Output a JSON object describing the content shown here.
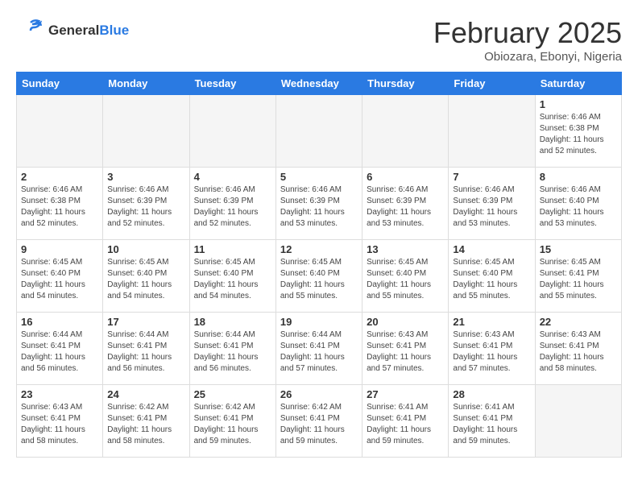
{
  "logo": {
    "general": "General",
    "blue": "Blue"
  },
  "title": "February 2025",
  "location": "Obiozara, Ebonyi, Nigeria",
  "weekdays": [
    "Sunday",
    "Monday",
    "Tuesday",
    "Wednesday",
    "Thursday",
    "Friday",
    "Saturday"
  ],
  "weeks": [
    [
      {
        "day": "",
        "info": ""
      },
      {
        "day": "",
        "info": ""
      },
      {
        "day": "",
        "info": ""
      },
      {
        "day": "",
        "info": ""
      },
      {
        "day": "",
        "info": ""
      },
      {
        "day": "",
        "info": ""
      },
      {
        "day": "1",
        "info": "Sunrise: 6:46 AM\nSunset: 6:38 PM\nDaylight: 11 hours\nand 52 minutes."
      }
    ],
    [
      {
        "day": "2",
        "info": "Sunrise: 6:46 AM\nSunset: 6:38 PM\nDaylight: 11 hours\nand 52 minutes."
      },
      {
        "day": "3",
        "info": "Sunrise: 6:46 AM\nSunset: 6:39 PM\nDaylight: 11 hours\nand 52 minutes."
      },
      {
        "day": "4",
        "info": "Sunrise: 6:46 AM\nSunset: 6:39 PM\nDaylight: 11 hours\nand 52 minutes."
      },
      {
        "day": "5",
        "info": "Sunrise: 6:46 AM\nSunset: 6:39 PM\nDaylight: 11 hours\nand 53 minutes."
      },
      {
        "day": "6",
        "info": "Sunrise: 6:46 AM\nSunset: 6:39 PM\nDaylight: 11 hours\nand 53 minutes."
      },
      {
        "day": "7",
        "info": "Sunrise: 6:46 AM\nSunset: 6:39 PM\nDaylight: 11 hours\nand 53 minutes."
      },
      {
        "day": "8",
        "info": "Sunrise: 6:46 AM\nSunset: 6:40 PM\nDaylight: 11 hours\nand 53 minutes."
      }
    ],
    [
      {
        "day": "9",
        "info": "Sunrise: 6:45 AM\nSunset: 6:40 PM\nDaylight: 11 hours\nand 54 minutes."
      },
      {
        "day": "10",
        "info": "Sunrise: 6:45 AM\nSunset: 6:40 PM\nDaylight: 11 hours\nand 54 minutes."
      },
      {
        "day": "11",
        "info": "Sunrise: 6:45 AM\nSunset: 6:40 PM\nDaylight: 11 hours\nand 54 minutes."
      },
      {
        "day": "12",
        "info": "Sunrise: 6:45 AM\nSunset: 6:40 PM\nDaylight: 11 hours\nand 55 minutes."
      },
      {
        "day": "13",
        "info": "Sunrise: 6:45 AM\nSunset: 6:40 PM\nDaylight: 11 hours\nand 55 minutes."
      },
      {
        "day": "14",
        "info": "Sunrise: 6:45 AM\nSunset: 6:40 PM\nDaylight: 11 hours\nand 55 minutes."
      },
      {
        "day": "15",
        "info": "Sunrise: 6:45 AM\nSunset: 6:41 PM\nDaylight: 11 hours\nand 55 minutes."
      }
    ],
    [
      {
        "day": "16",
        "info": "Sunrise: 6:44 AM\nSunset: 6:41 PM\nDaylight: 11 hours\nand 56 minutes."
      },
      {
        "day": "17",
        "info": "Sunrise: 6:44 AM\nSunset: 6:41 PM\nDaylight: 11 hours\nand 56 minutes."
      },
      {
        "day": "18",
        "info": "Sunrise: 6:44 AM\nSunset: 6:41 PM\nDaylight: 11 hours\nand 56 minutes."
      },
      {
        "day": "19",
        "info": "Sunrise: 6:44 AM\nSunset: 6:41 PM\nDaylight: 11 hours\nand 57 minutes."
      },
      {
        "day": "20",
        "info": "Sunrise: 6:43 AM\nSunset: 6:41 PM\nDaylight: 11 hours\nand 57 minutes."
      },
      {
        "day": "21",
        "info": "Sunrise: 6:43 AM\nSunset: 6:41 PM\nDaylight: 11 hours\nand 57 minutes."
      },
      {
        "day": "22",
        "info": "Sunrise: 6:43 AM\nSunset: 6:41 PM\nDaylight: 11 hours\nand 58 minutes."
      }
    ],
    [
      {
        "day": "23",
        "info": "Sunrise: 6:43 AM\nSunset: 6:41 PM\nDaylight: 11 hours\nand 58 minutes."
      },
      {
        "day": "24",
        "info": "Sunrise: 6:42 AM\nSunset: 6:41 PM\nDaylight: 11 hours\nand 58 minutes."
      },
      {
        "day": "25",
        "info": "Sunrise: 6:42 AM\nSunset: 6:41 PM\nDaylight: 11 hours\nand 59 minutes."
      },
      {
        "day": "26",
        "info": "Sunrise: 6:42 AM\nSunset: 6:41 PM\nDaylight: 11 hours\nand 59 minutes."
      },
      {
        "day": "27",
        "info": "Sunrise: 6:41 AM\nSunset: 6:41 PM\nDaylight: 11 hours\nand 59 minutes."
      },
      {
        "day": "28",
        "info": "Sunrise: 6:41 AM\nSunset: 6:41 PM\nDaylight: 11 hours\nand 59 minutes."
      },
      {
        "day": "",
        "info": ""
      }
    ]
  ]
}
